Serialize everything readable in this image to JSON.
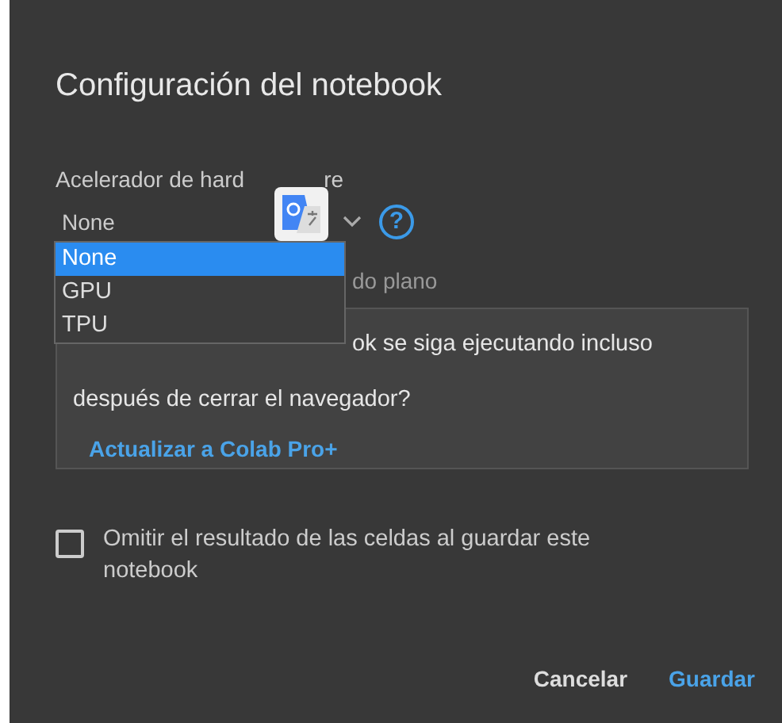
{
  "dialog": {
    "title": "Configuración del notebook",
    "accelerator": {
      "label_parts": [
        "Acelerador de hard",
        "re"
      ],
      "value": "None",
      "help": "?",
      "options": [
        {
          "label": "None",
          "selected": true
        },
        {
          "label": "GPU",
          "selected": false
        },
        {
          "label": "TPU",
          "selected": false
        }
      ]
    },
    "partial_text": "do plano",
    "upsell": {
      "lines": [
        "ok se siga ejecutando incluso",
        "después de cerrar el navegador?"
      ],
      "link": "Actualizar a Colab Pro+"
    },
    "omit_output": {
      "label": "Omitir el resultado de las celdas al guardar este notebook",
      "checked": false
    },
    "buttons": [
      {
        "label": "Cancelar",
        "kind": "secondary"
      },
      {
        "label": "Guardar",
        "kind": "primary"
      }
    ]
  }
}
